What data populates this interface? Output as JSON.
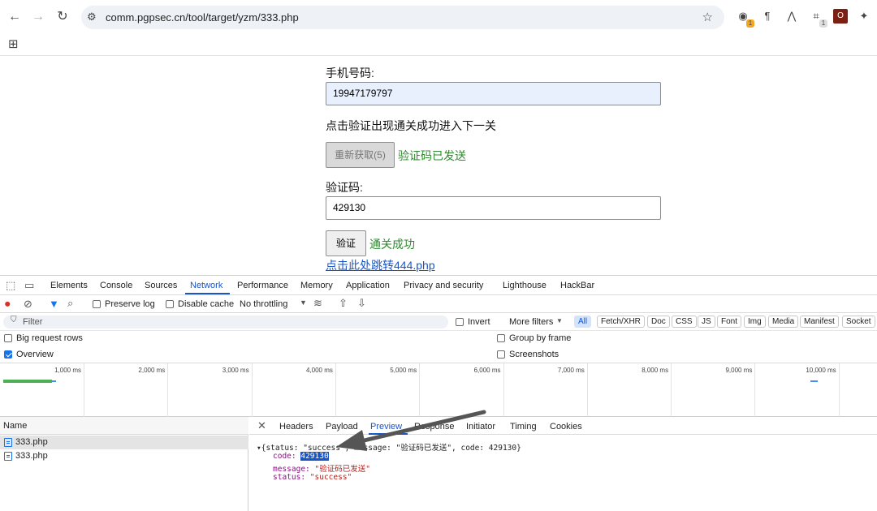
{
  "browser": {
    "url": "comm.pgpsec.cn/tool/target/yzm/333.php",
    "extensions": [
      {
        "name": "ext-circle-icon",
        "glyph": "◉",
        "badge": "1",
        "badge_color": "#f4a623"
      },
      {
        "name": "pilcrow-icon",
        "glyph": "¶",
        "badge": "",
        "badge_color": ""
      },
      {
        "name": "mountain-icon",
        "glyph": "⋀",
        "badge": "",
        "badge_color": ""
      },
      {
        "name": "capture-icon",
        "glyph": "⌗",
        "badge": "1",
        "badge_color": "#dddddd"
      },
      {
        "name": "ext-red-icon",
        "glyph": "O",
        "badge": "",
        "badge_color": ""
      },
      {
        "name": "puzzle-icon",
        "glyph": "✦",
        "badge": "",
        "badge_color": ""
      }
    ]
  },
  "page": {
    "phone_label": "手机号码:",
    "phone_value": "19947179797",
    "instruction": "点击验证出现通关成功进入下一关",
    "resend_button": "重新获取(5)",
    "sent_status": "验证码已发送",
    "code_label": "验证码:",
    "code_value": "429130",
    "verify_button": "验证",
    "success_status": "通关成功",
    "next_link": "点击此处跳转444.php"
  },
  "devtools": {
    "tabs": [
      "Elements",
      "Console",
      "Sources",
      "Network",
      "Performance",
      "Memory",
      "Application",
      "Privacy and security",
      "Lighthouse",
      "HackBar"
    ],
    "active_tab": "Network",
    "preserve_log": "Preserve log",
    "disable_cache": "Disable cache",
    "throttling": "No throttling",
    "filter_placeholder": "Filter",
    "invert": "Invert",
    "more_filters": "More filters",
    "type_filters": [
      "All",
      "Fetch/XHR",
      "Doc",
      "CSS",
      "JS",
      "Font",
      "Img",
      "Media",
      "Manifest",
      "Socket"
    ],
    "big_request_rows": "Big request rows",
    "group_by_frame": "Group by frame",
    "overview": "Overview",
    "screenshots": "Screenshots",
    "overview_checked": true,
    "timeline_ticks": [
      "1,000 ms",
      "2,000 ms",
      "3,000 ms",
      "4,000 ms",
      "5,000 ms",
      "6,000 ms",
      "7,000 ms",
      "8,000 ms",
      "9,000 ms",
      "10,000 ms"
    ],
    "name_header": "Name",
    "requests": [
      "333.php",
      "333.php"
    ],
    "detail_tabs": [
      "Headers",
      "Payload",
      "Preview",
      "Response",
      "Initiator",
      "Timing",
      "Cookies"
    ],
    "active_detail_tab": "Preview",
    "preview": {
      "summary": "{status: \"success\", message: \"验证码已发送\", code: 429130}",
      "code_key": "code:",
      "code_val": "429130",
      "message_key": "message:",
      "message_val": "\"验证码已发送\"",
      "status_key": "status:",
      "status_val": "\"success\""
    }
  }
}
